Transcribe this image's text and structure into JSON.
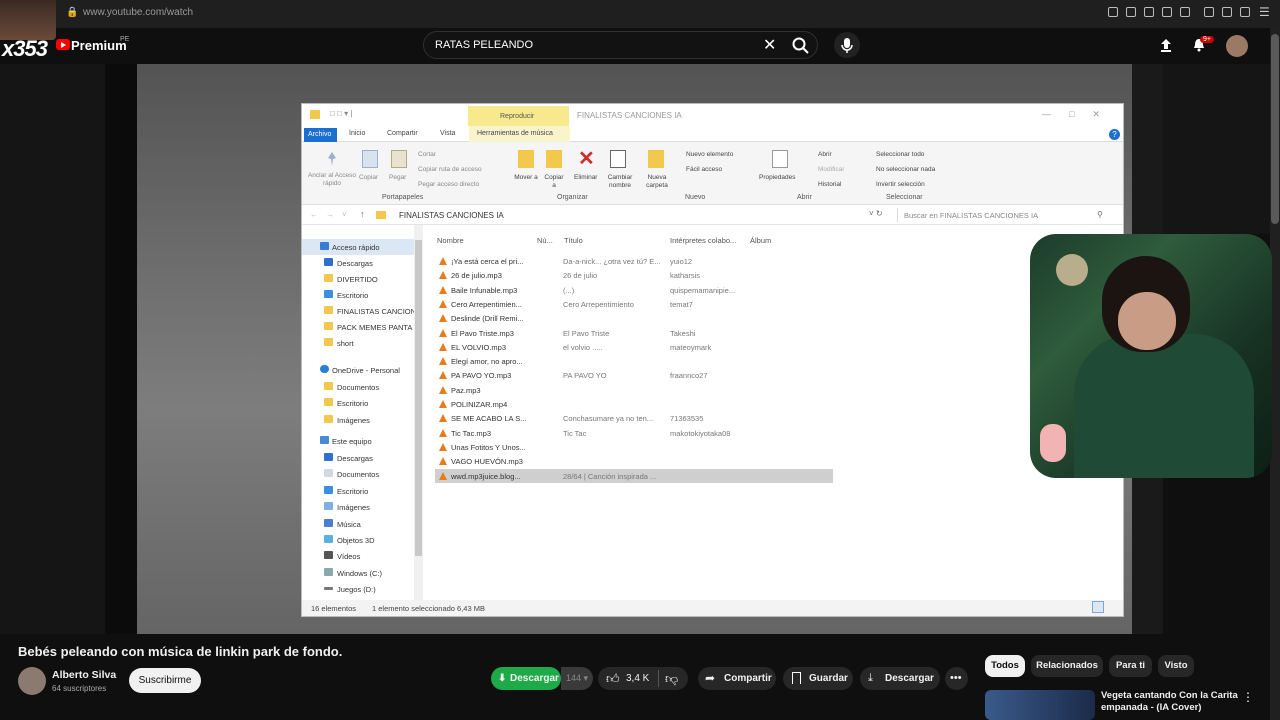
{
  "browser": {
    "url": "www.youtube.com/watch"
  },
  "header": {
    "channel_overlay_text": "x353",
    "logo_label": "Premium",
    "region": "PE",
    "search_query": "RATAS PELEANDO",
    "notifications_badge": "9+"
  },
  "explorer": {
    "music_tab": "Reproducir",
    "window_title": "FINALISTAS CANCIONES IA",
    "ribbon_tabs": [
      "Archivo",
      "Inicio",
      "Compartir",
      "Vista",
      "Herramientas de música"
    ],
    "ribbon": {
      "pin": "Anclar al Acceso rápido",
      "copy": "Copiar",
      "paste": "Pegar",
      "cut": "Cortar",
      "copy_path": "Copiar ruta de acceso",
      "paste_shortcut": "Pegar acceso directo",
      "move": "Mover a",
      "copy_to": "Copiar a",
      "delete": "Eliminar",
      "rename": "Cambiar nombre",
      "new_folder": "Nueva carpeta",
      "new_item": "Nuevo elemento",
      "easy_access": "Fácil acceso",
      "properties": "Propiedades",
      "open": "Abrir",
      "modify": "Modificar",
      "history": "Historial",
      "select_all": "Seleccionar todo",
      "select_none": "No seleccionar nada",
      "invert": "Invertir selección",
      "groups": [
        "Portapapeles",
        "Organizar",
        "Nuevo",
        "Abrir",
        "Seleccionar"
      ]
    },
    "path": "FINALISTAS CANCIONES IA",
    "search_placeholder": "Buscar en FINALISTAS CANCIONES IA",
    "nav": [
      "Acceso rápido",
      "Descargas",
      "DIVERTIDO",
      "Escritorio",
      "FINALISTAS CANCION",
      "PACK MEMES PANTA",
      "short",
      "OneDrive - Personal",
      "Documentos",
      "Escritorio",
      "Imágenes",
      "Este equipo",
      "Descargas",
      "Documentos",
      "Escritorio",
      "Imágenes",
      "Música",
      "Objetos 3D",
      "Vídeos",
      "Windows (C:)",
      "Juegos (D:)"
    ],
    "columns": [
      "Nombre",
      "Nú...",
      "Título",
      "Intérpretes colabo...",
      "Álbum"
    ],
    "files": [
      {
        "name": "¡Ya está cerca el pri...",
        "title": "Da-a-nick... ¿otra vez tú? E...",
        "artist": "yuio12"
      },
      {
        "name": "26 de julio.mp3",
        "title": "26 de julio",
        "artist": "katharsis"
      },
      {
        "name": "Baile Infunable.mp3",
        "title": "(...)",
        "artist": "quispemamanipie..."
      },
      {
        "name": "Cero Arrepentimien...",
        "title": "Cero Arrepentimiento",
        "artist": "temat7"
      },
      {
        "name": "Deslinde (Drill Remi...",
        "title": "",
        "artist": ""
      },
      {
        "name": "El Pavo Triste.mp3",
        "title": "El Pavo Triste",
        "artist": "Takeshi"
      },
      {
        "name": "EL VOLVIO.mp3",
        "title": "el volvio .....",
        "artist": "mateoymark"
      },
      {
        "name": "Elegí amor, no apro...",
        "title": "",
        "artist": ""
      },
      {
        "name": "PA PAVO YO.mp3",
        "title": "PA PAVO YO",
        "artist": "fraannco27"
      },
      {
        "name": "Paz.mp3",
        "title": "",
        "artist": ""
      },
      {
        "name": "POLINIZAR.mp4",
        "title": "",
        "artist": ""
      },
      {
        "name": "SE ME ACABO LA S...",
        "title": "Conchasumare ya no ten...",
        "artist": "71363535"
      },
      {
        "name": "Tic Tac.mp3",
        "title": "Tic Tac",
        "artist": "makotokiyotaka08"
      },
      {
        "name": "Unas Fotitos Y Unos...",
        "title": "",
        "artist": ""
      },
      {
        "name": "VAGO HUEVÓN.mp3",
        "title": "",
        "artist": ""
      },
      {
        "name": "wwd.mp3juice.blog...",
        "title": "28/64 | Canción inspirada ...",
        "artist": ""
      }
    ],
    "status_count": "16 elementos",
    "status_selected": "1 elemento seleccionado  6,43 MB"
  },
  "video": {
    "title": "Bebés peleando con música de linkin park de fondo.",
    "channel": "Alberto Silva",
    "subscribers": "64 suscriptores",
    "subscribe": "Suscribirme",
    "download_green": "Descargar",
    "download_count": "144",
    "likes": "3,4 K",
    "share": "Compartir",
    "save": "Guardar",
    "download": "Descargar"
  },
  "chips": [
    "Todos",
    "Relacionados",
    "Para ti",
    "Visto"
  ],
  "recommendation": {
    "title": "Vegeta cantando Con la Carita empanada - (IA Cover)"
  },
  "colors": {
    "yt_red": "#ff0000",
    "download_green": "#1faa4a",
    "selection": "#cfcfcf",
    "explorer_accent": "#1a6fd0"
  }
}
